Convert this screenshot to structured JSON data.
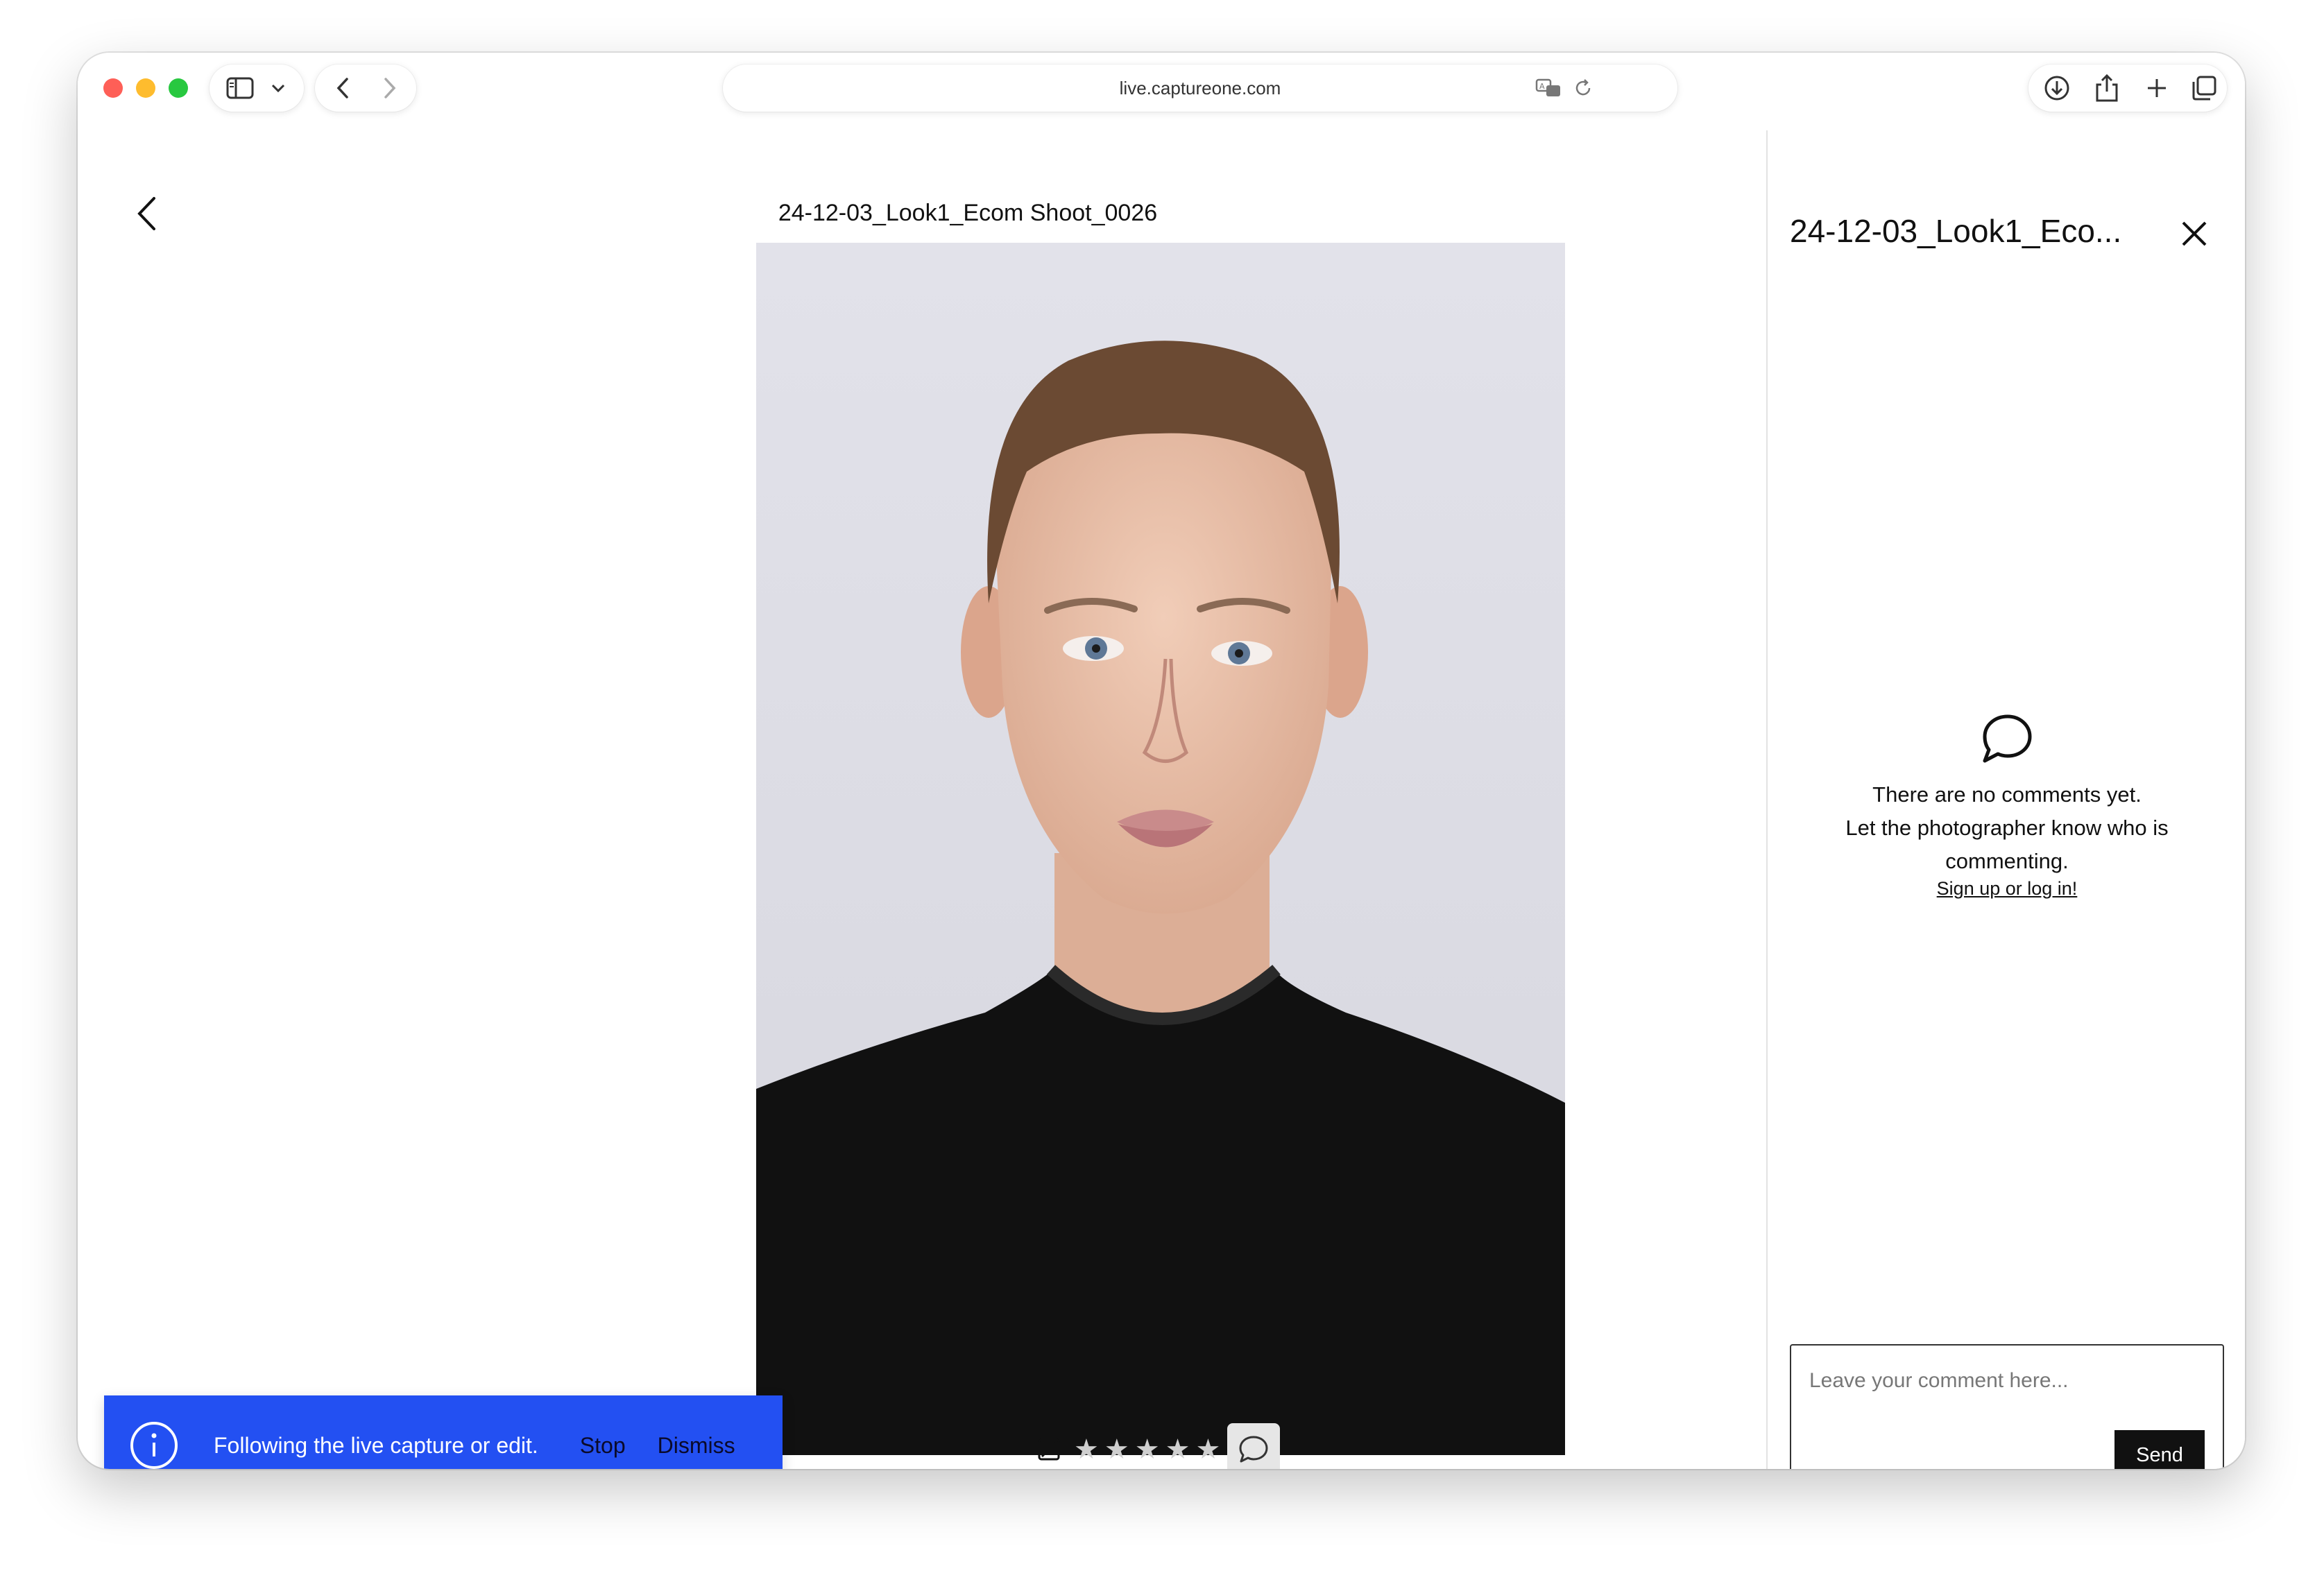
{
  "browser": {
    "url": "live.captureone.com",
    "icons": [
      "sidebar-icon",
      "chevron-down-icon",
      "back-arrow-icon",
      "forward-arrow-icon",
      "translate-icon",
      "reload-icon",
      "download-icon",
      "share-icon",
      "new-tab-icon",
      "tabs-overview-icon"
    ]
  },
  "viewer": {
    "image_title": "24-12-03_Look1_Ecom Shoot_0026",
    "photo_alt": "Portrait of a young man with short brown hair wearing a black t-shirt against a light grey background",
    "rating": {
      "value": 0,
      "max": 5
    },
    "star_glyph": "★"
  },
  "side_panel": {
    "title": "24-12-03_Look1_Eco...",
    "empty_line1": "There are no comments yet.",
    "empty_line2": "Let the photographer know who is",
    "empty_line3": "commenting.",
    "signup_link": "Sign up or log in!",
    "comment_placeholder": "Leave your comment here...",
    "send_label": "Send"
  },
  "toast": {
    "message": "Following the live capture or edit.",
    "stop_label": "Stop",
    "dismiss_label": "Dismiss"
  },
  "colors": {
    "toast_bg": "#2350f2",
    "send_bg": "#111111",
    "star_inactive": "#cfcfcf"
  }
}
